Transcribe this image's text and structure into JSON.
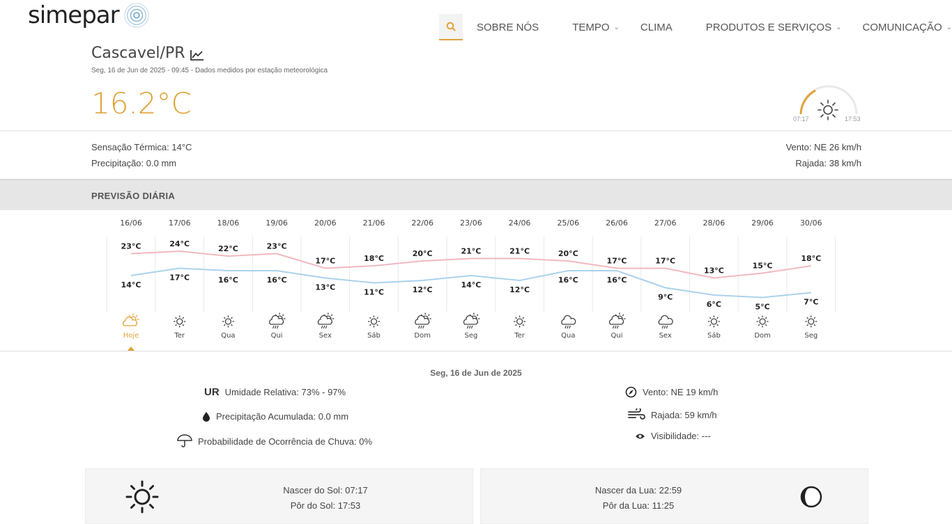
{
  "brand": {
    "name": "simepar"
  },
  "nav": {
    "items": [
      {
        "label": "SOBRE NÓS",
        "has_dropdown": false
      },
      {
        "label": "TEMPO",
        "has_dropdown": true
      },
      {
        "label": "CLIMA",
        "has_dropdown": false
      },
      {
        "label": "PRODUTOS E SERVIÇOS",
        "has_dropdown": true
      },
      {
        "label": "COMUNICAÇÃO",
        "has_dropdown": true
      }
    ],
    "search_icon": "search-icon"
  },
  "current": {
    "city": "Cascavel/PR",
    "subtitle": "Seg, 16 de Jun de 2025 - 09:45 - Dados medidos por estação meteorológica",
    "temperature": "16.2°C",
    "feels_like": "Sensação Térmica: 14°C",
    "precipitation": "Precipitação: 0.0 mm",
    "wind": "Vento: NE 26 km/h",
    "gust": "Rajada: 38 km/h",
    "sunrise_short": "07:17",
    "sunset_short": "17:53"
  },
  "forecast": {
    "title": "PREVISÃO DIÁRIA",
    "days": [
      {
        "date": "16/06",
        "max": "23°C",
        "min": "14°C",
        "weekday": "Hoje",
        "icon": "partly-cloudy-icon"
      },
      {
        "date": "17/06",
        "max": "24°C",
        "min": "17°C",
        "weekday": "Ter",
        "icon": "sun-icon"
      },
      {
        "date": "18/06",
        "max": "22°C",
        "min": "16°C",
        "weekday": "Qua",
        "icon": "sun-icon"
      },
      {
        "date": "19/06",
        "max": "23°C",
        "min": "16°C",
        "weekday": "Qui",
        "icon": "sun-rain-icon"
      },
      {
        "date": "20/06",
        "max": "17°C",
        "min": "13°C",
        "weekday": "Sex",
        "icon": "sun-rain-icon"
      },
      {
        "date": "21/06",
        "max": "18°C",
        "min": "11°C",
        "weekday": "Sáb",
        "icon": "sun-icon"
      },
      {
        "date": "22/06",
        "max": "20°C",
        "min": "12°C",
        "weekday": "Dom",
        "icon": "sun-rain-icon"
      },
      {
        "date": "23/06",
        "max": "21°C",
        "min": "14°C",
        "weekday": "Seg",
        "icon": "sun-rain-icon"
      },
      {
        "date": "24/06",
        "max": "21°C",
        "min": "12°C",
        "weekday": "Ter",
        "icon": "sun-icon"
      },
      {
        "date": "25/06",
        "max": "20°C",
        "min": "16°C",
        "weekday": "Qua",
        "icon": "rain-icon"
      },
      {
        "date": "26/06",
        "max": "17°C",
        "min": "16°C",
        "weekday": "Qui",
        "icon": "sun-rain-icon"
      },
      {
        "date": "27/06",
        "max": "17°C",
        "min": "9°C",
        "weekday": "Sex",
        "icon": "rain-icon"
      },
      {
        "date": "28/06",
        "max": "13°C",
        "min": "6°C",
        "weekday": "Sáb",
        "icon": "sun-icon"
      },
      {
        "date": "29/06",
        "max": "15°C",
        "min": "5°C",
        "weekday": "Dom",
        "icon": "sun-icon"
      },
      {
        "date": "30/06",
        "max": "18°C",
        "min": "7°C",
        "weekday": "Seg",
        "icon": "sun-icon"
      }
    ]
  },
  "chart_data": {
    "type": "line",
    "categories": [
      "16/06",
      "17/06",
      "18/06",
      "19/06",
      "20/06",
      "21/06",
      "22/06",
      "23/06",
      "24/06",
      "25/06",
      "26/06",
      "27/06",
      "28/06",
      "29/06",
      "30/06"
    ],
    "series": [
      {
        "values": [
          23,
          24,
          22,
          23,
          17,
          18,
          20,
          21,
          21,
          20,
          17,
          17,
          13,
          15,
          18
        ],
        "color": "#f2b8bd"
      },
      {
        "values": [
          14,
          17,
          16,
          16,
          13,
          11,
          12,
          14,
          12,
          16,
          16,
          9,
          6,
          5,
          7
        ],
        "color": "#a9d2ec"
      }
    ],
    "ylim": [
      0,
      30
    ],
    "legend": "none"
  },
  "detail": {
    "date": "Seg, 16 de Jun de 2025",
    "ur_abbr": "UR",
    "humidity": "Umidade Relativa: 73% - 97%",
    "precip_acc": "Precipitação Acumulada: 0.0 mm",
    "rain_prob": "Probabilidade de Ocorrência de Chuva: 0%",
    "wind": "Vento: NE 19 km/h",
    "gust": "Rajada: 59 km/h",
    "visibility": "Visibilidade: ---"
  },
  "sun_moon": {
    "sunrise": "Nascer do Sol: 07:17",
    "sunset": "Pôr do Sol: 17:53",
    "moonrise": "Nascer da Lua: 22:59",
    "moonset": "Pôr da Lua: 11:25"
  },
  "colors": {
    "accent": "#e0a33a",
    "max_line": "#f2b8bd",
    "min_line": "#a9d2ec"
  }
}
